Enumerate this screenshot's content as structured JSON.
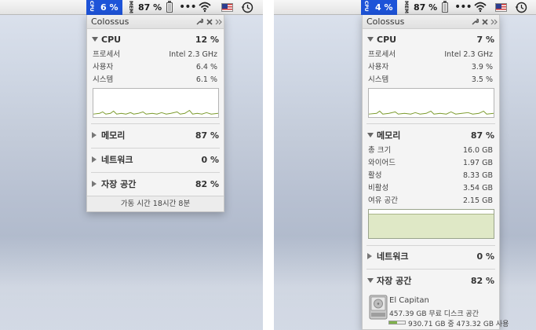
{
  "left": {
    "menubar": {
      "cpu_label": "CPU",
      "cpu_percent": "6 %",
      "mem_label": "MEM",
      "mem_percent": "87 %"
    },
    "panel": {
      "title": "Colossus",
      "cpu": {
        "label": "CPU",
        "value": "12 %",
        "rows": [
          {
            "label": "프로세서",
            "value": "Intel 2.3 GHz"
          },
          {
            "label": "사용자",
            "value": "6.4 %"
          },
          {
            "label": "시스템",
            "value": "6.1 %"
          }
        ]
      },
      "memory": {
        "label": "메모리",
        "value": "87 %"
      },
      "network": {
        "label": "네트워크",
        "value": "0 %"
      },
      "storage": {
        "label": "자장 공간",
        "value": "82 %"
      },
      "footer": "가동 시간 18시간 8분"
    }
  },
  "right": {
    "menubar": {
      "cpu_label": "CPU",
      "cpu_percent": "4 %",
      "mem_label": "MEM",
      "mem_percent": "87 %"
    },
    "panel": {
      "title": "Colossus",
      "cpu": {
        "label": "CPU",
        "value": "7 %",
        "rows": [
          {
            "label": "프로세서",
            "value": "Intel 2.3 GHz"
          },
          {
            "label": "사용자",
            "value": "3.9 %"
          },
          {
            "label": "시스템",
            "value": "3.5 %"
          }
        ]
      },
      "memory": {
        "label": "메모리",
        "value": "87 %",
        "rows": [
          {
            "label": "총 크기",
            "value": "16.0 GB"
          },
          {
            "label": "와이어드",
            "value": "1.97 GB"
          },
          {
            "label": "활성",
            "value": "8.33 GB"
          },
          {
            "label": "비활성",
            "value": "3.54 GB"
          },
          {
            "label": "여유 공간",
            "value": "2.15 GB"
          }
        ],
        "graph_used_fraction": 0.87
      },
      "network": {
        "label": "네트워크",
        "value": "0 %"
      },
      "storage": {
        "label": "자장 공간",
        "value": "82 %",
        "disk_name": "El Capitan",
        "disk_free": "457.39 GB 무료 디스크 공간",
        "disk_usage": "930.71 GB 중 473.32 GB 사용",
        "disk_used_fraction": 0.51
      }
    }
  },
  "icons": [
    "wrench-icon",
    "close-icon",
    "expand-icon",
    "wifi-icon",
    "us-flag-icon",
    "time-machine-icon",
    "battery-icon",
    "more-icon",
    "hard-drive-icon"
  ],
  "colors": {
    "menubar_highlight": "#1d53d8",
    "graph_line": "#7a9a2b",
    "memory_fill": "#dfe8c6"
  }
}
